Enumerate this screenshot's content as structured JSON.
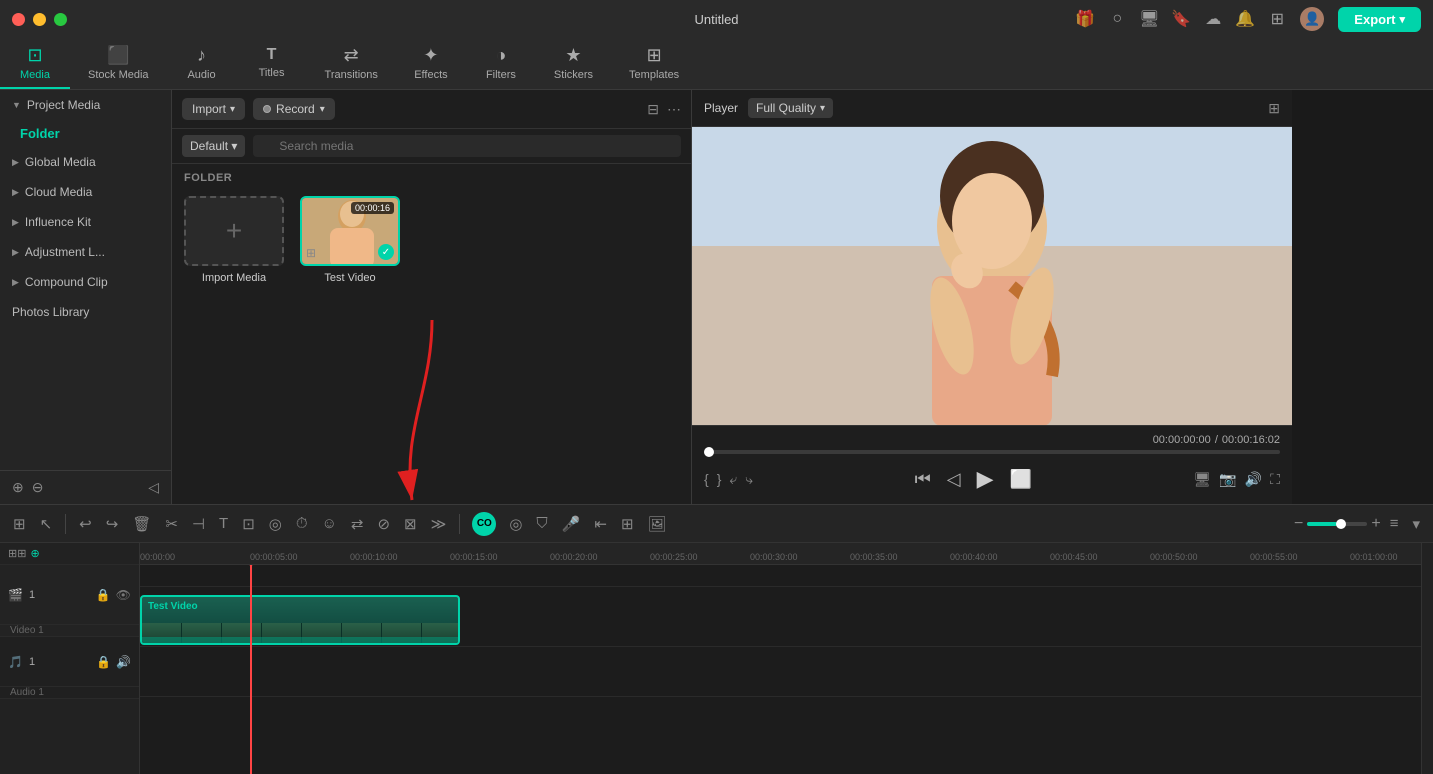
{
  "app": {
    "title": "Untitled",
    "window_controls": {
      "close": "close",
      "minimize": "minimize",
      "maximize": "maximize"
    }
  },
  "titlebar": {
    "title": "Untitled",
    "export_label": "Export",
    "icons": [
      "gift",
      "circle",
      "monitor",
      "bookmark",
      "cloud-up",
      "bell",
      "grid",
      "avatar"
    ]
  },
  "toolbar": {
    "tabs": [
      {
        "id": "media",
        "label": "Media",
        "icon": "📷",
        "active": true
      },
      {
        "id": "stock-media",
        "label": "Stock Media",
        "icon": "🎬"
      },
      {
        "id": "audio",
        "label": "Audio",
        "icon": "🎵"
      },
      {
        "id": "titles",
        "label": "Titles",
        "icon": "T"
      },
      {
        "id": "transitions",
        "label": "Transitions",
        "icon": "↔"
      },
      {
        "id": "effects",
        "label": "Effects",
        "icon": "✨"
      },
      {
        "id": "filters",
        "label": "Filters",
        "icon": "🎨"
      },
      {
        "id": "stickers",
        "label": "Stickers",
        "icon": "⭐"
      },
      {
        "id": "templates",
        "label": "Templates",
        "icon": "⊞"
      }
    ]
  },
  "sidebar": {
    "items": [
      {
        "label": "Project Media",
        "arrow": "▼",
        "active": false
      },
      {
        "label": "Folder",
        "type": "folder",
        "active": true
      },
      {
        "label": "Global Media",
        "arrow": "▶",
        "active": false
      },
      {
        "label": "Cloud Media",
        "arrow": "▶",
        "active": false
      },
      {
        "label": "Influence Kit",
        "arrow": "▶",
        "active": false
      },
      {
        "label": "Adjustment L...",
        "arrow": "▶",
        "active": false
      },
      {
        "label": "Compound Clip",
        "arrow": "▶",
        "active": false
      },
      {
        "label": "Photos Library",
        "active": false
      }
    ]
  },
  "media_panel": {
    "import_label": "Import",
    "record_label": "Record",
    "default_label": "Default",
    "search_placeholder": "Search media",
    "folder_label": "FOLDER",
    "items": [
      {
        "type": "import",
        "label": "Import Media"
      },
      {
        "type": "video",
        "label": "Test Video",
        "duration": "00:00:16",
        "has_check": true
      }
    ]
  },
  "player": {
    "label": "Player",
    "quality": "Full Quality",
    "current_time": "00:00:00:00",
    "total_time": "00:00:16:02",
    "controls": [
      "step-back",
      "step-forward",
      "play",
      "stop"
    ]
  },
  "timeline": {
    "tracks": [
      {
        "type": "video",
        "number": "1",
        "label": "Video 1"
      },
      {
        "type": "audio",
        "number": "1",
        "label": "Audio 1"
      }
    ],
    "ruler_marks": [
      "00:00:00",
      "00:00:05:00",
      "00:00:10:00",
      "00:00:15:00",
      "00:00:20:00",
      "00:00:25:00",
      "00:00:30:00",
      "00:00:35:00",
      "00:00:40:00",
      "00:00:45:00",
      "00:00:50:00",
      "00:00:55:00",
      "00:01:00:00"
    ],
    "clip": {
      "label": "Test Video",
      "track": "video"
    }
  }
}
